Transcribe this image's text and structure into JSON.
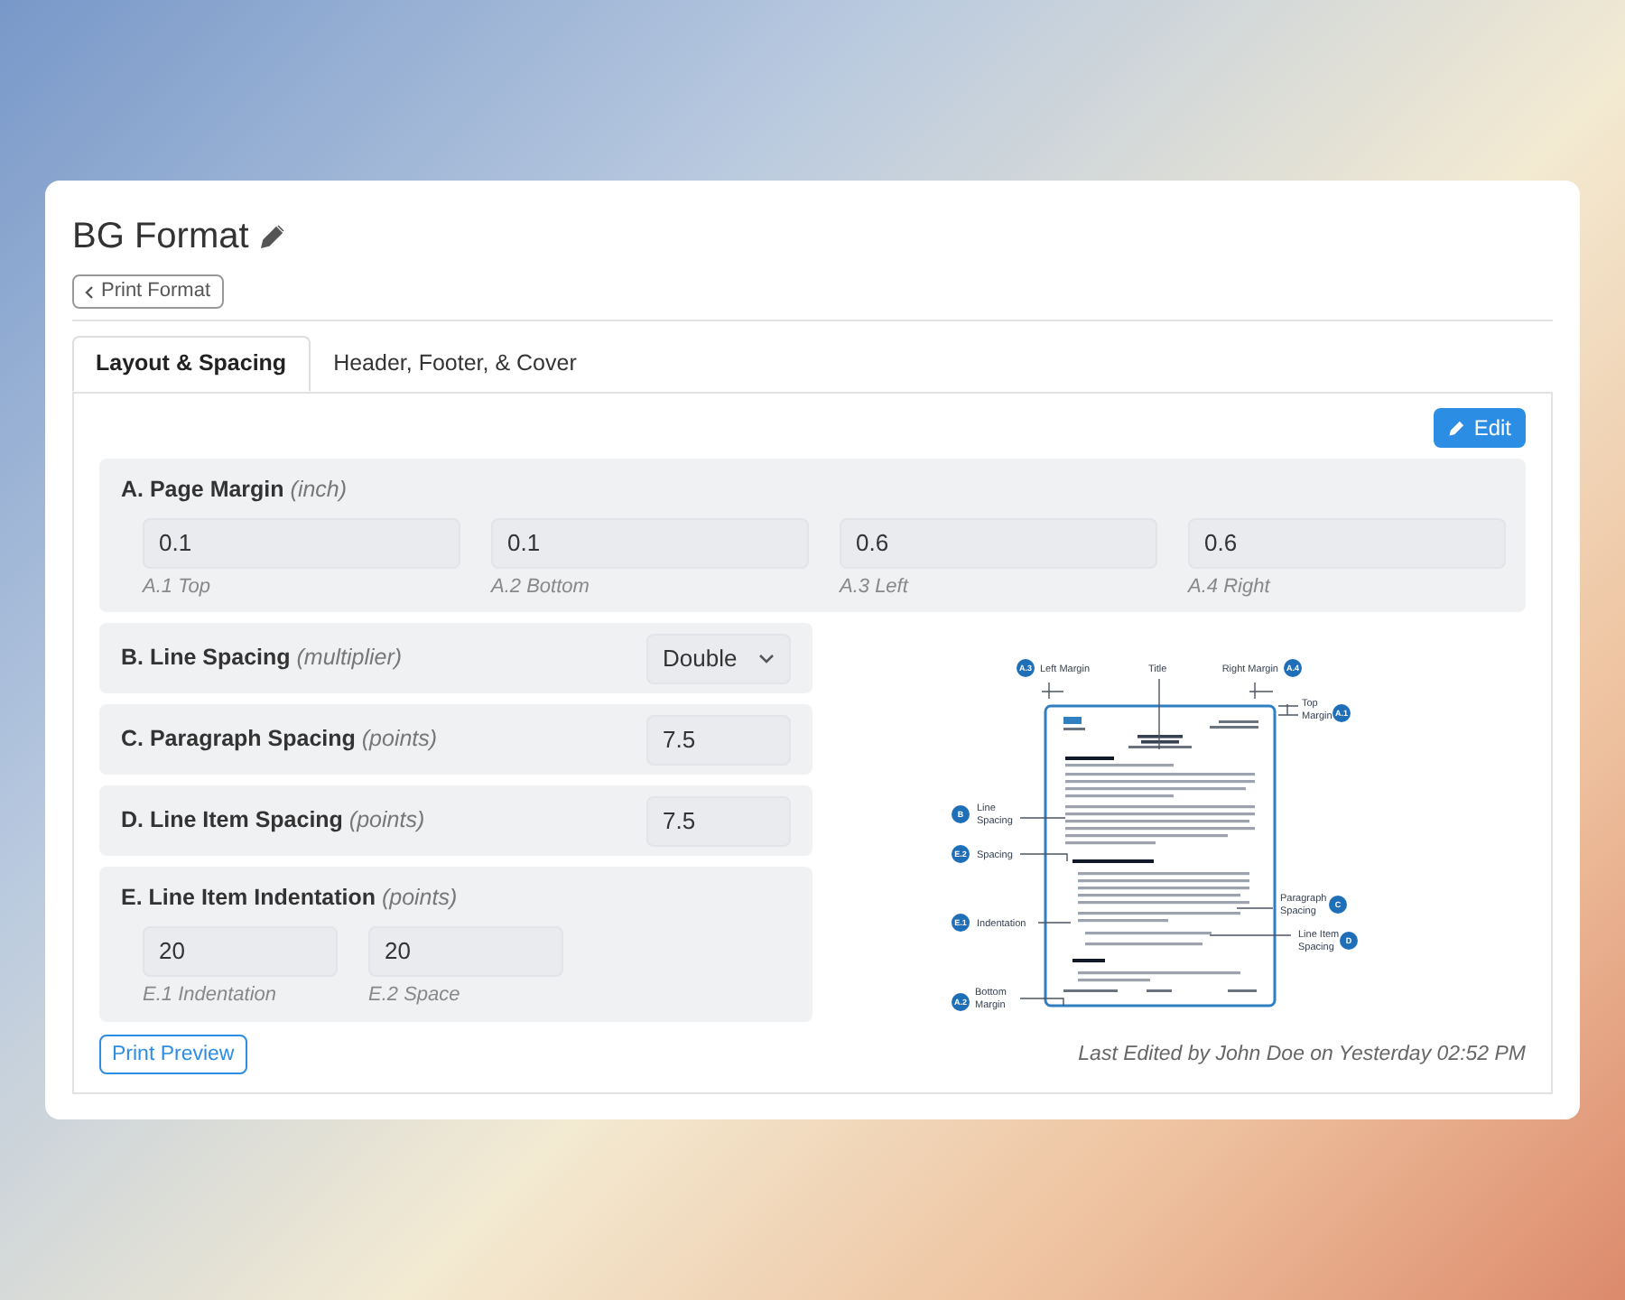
{
  "title": "BG Format",
  "back_button": "Print Format",
  "tabs": [
    {
      "label": "Layout & Spacing",
      "selected": true
    },
    {
      "label": "Header, Footer, & Cover",
      "selected": false
    }
  ],
  "edit_button": "Edit",
  "sections": [
    {
      "kind": "grid",
      "title": "A. Page Margin",
      "unit": "(inch)",
      "fields": [
        {
          "value": "0.1",
          "caption": "A.1 Top"
        },
        {
          "value": "0.1",
          "caption": "A.2 Bottom"
        },
        {
          "value": "0.6",
          "caption": "A.3 Left"
        },
        {
          "value": "0.6",
          "caption": "A.4 Right"
        }
      ]
    },
    {
      "kind": "select",
      "title": "B. Line Spacing",
      "unit": "(multiplier)",
      "value": "Double"
    },
    {
      "kind": "input",
      "title": "C. Paragraph Spacing",
      "unit": "(points)",
      "value": "7.5"
    },
    {
      "kind": "input",
      "title": "D. Line Item Spacing",
      "unit": "(points)",
      "value": "7.5"
    },
    {
      "kind": "grid",
      "title": "E. Line Item Indentation",
      "unit": "(points)",
      "fields": [
        {
          "value": "20",
          "caption": "E.1 Indentation"
        },
        {
          "value": "20",
          "caption": "E.2 Space"
        }
      ]
    }
  ],
  "preview_diagram": {
    "callouts": [
      {
        "badge": "A.3",
        "lines": [
          "Left Margin"
        ]
      },
      {
        "lines": [
          "Title"
        ]
      },
      {
        "badge": "A.4",
        "lines": [
          "Right Margin"
        ]
      },
      {
        "badge": "A.1",
        "lines": [
          "Top",
          "Margin"
        ]
      },
      {
        "badge": "B",
        "lines": [
          "Line",
          "Spacing"
        ]
      },
      {
        "badge": "E.2",
        "lines": [
          "Spacing"
        ]
      },
      {
        "badge": "E.1",
        "lines": [
          "Indentation"
        ]
      },
      {
        "badge": "A.2",
        "lines": [
          "Bottom",
          "Margin"
        ]
      },
      {
        "badge": "C",
        "lines": [
          "Paragraph",
          "Spacing"
        ]
      },
      {
        "badge": "D",
        "lines": [
          "Line Item",
          "Spacing"
        ]
      }
    ]
  },
  "print_preview_button": "Print Preview",
  "last_edited": "Last Edited by John Doe on Yesterday 02:52 PM"
}
